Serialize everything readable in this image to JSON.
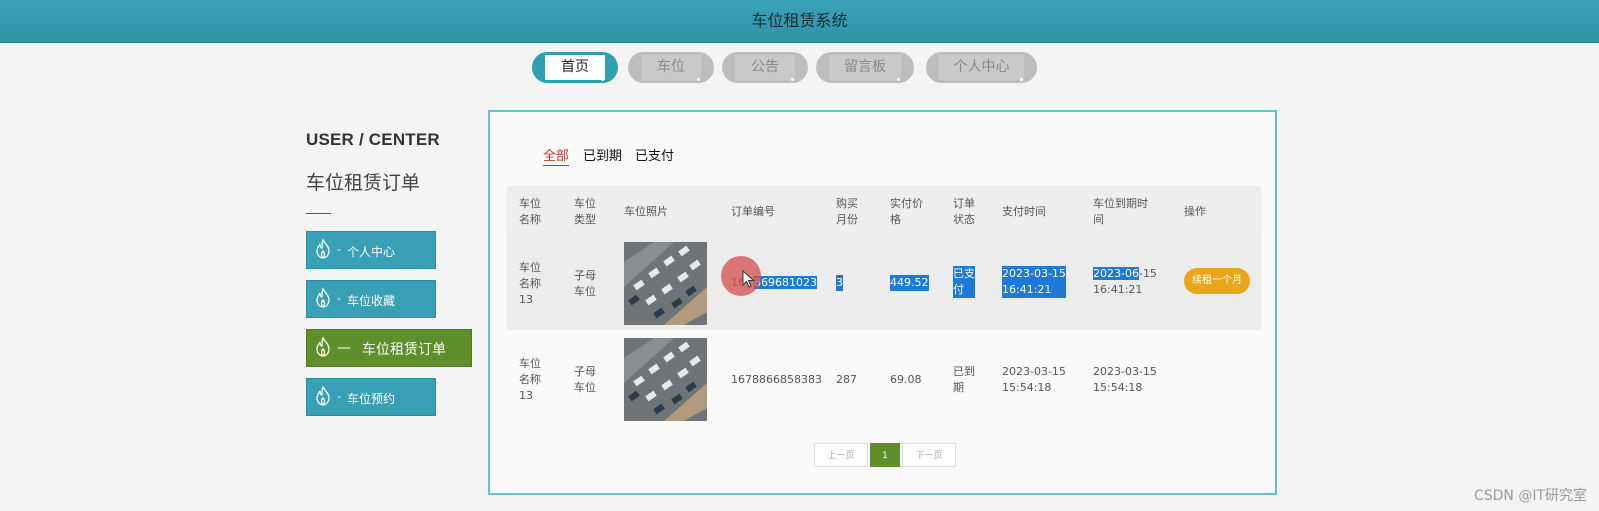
{
  "app": {
    "title": "车位租赁系统"
  },
  "nav": [
    {
      "label": "首页",
      "active": true
    },
    {
      "label": "车位",
      "active": false
    },
    {
      "label": "公告",
      "active": false
    },
    {
      "label": "留言板",
      "active": false
    },
    {
      "label": "个人中心",
      "active": false
    }
  ],
  "sidebar": {
    "title": "USER / CENTER",
    "subtitle": "车位租赁订单",
    "items": [
      {
        "label": "个人中心",
        "dash": "-",
        "active": false
      },
      {
        "label": "车位收藏",
        "dash": "-",
        "active": false
      },
      {
        "label": "车位租赁订单",
        "dash": "—",
        "active": true
      },
      {
        "label": "车位预约",
        "dash": "-",
        "active": false
      }
    ]
  },
  "tabs": [
    {
      "label": "全部",
      "active": true
    },
    {
      "label": "已到期",
      "active": false
    },
    {
      "label": "已支付",
      "active": false
    }
  ],
  "table": {
    "headers": [
      "车位\n名称",
      "车位\n类型",
      "车位照片",
      "订单编号",
      "购买\n月份",
      "实付价\n格",
      "订单\n状态",
      "支付时间",
      "车位到期时\n间",
      "操作"
    ],
    "rows": [
      {
        "name": "车位\n名称\n13",
        "type": "子母\n车位",
        "order_prefix": "16",
        "order_hidden": "7",
        "order_selected": "869681023",
        "months": "3",
        "price": "449.52",
        "status": "已支\n付",
        "pay_time": "2023-03-15\n16:41:21",
        "expire_sel": "2023-06",
        "expire_rest": "-15\n16:41:21",
        "action": "续租一个月"
      },
      {
        "name": "车位\n名称\n13",
        "type": "子母\n车位",
        "order_no": "1678866858383",
        "months": "287",
        "price": "69.08",
        "status": "已到\n期",
        "pay_time": "2023-03-15\n15:54:18",
        "expire_time": "2023-03-15\n15:54:18"
      }
    ]
  },
  "pager": {
    "prev": "上一页",
    "current": "1",
    "next": "下一页"
  },
  "watermark": "CSDN @IT研究室",
  "colors": {
    "header": "#2f9fb2",
    "accent_green": "#5f8f2a",
    "teal": "#37a0b4",
    "orange": "#e9a61b",
    "select": "#1e7ad8"
  }
}
